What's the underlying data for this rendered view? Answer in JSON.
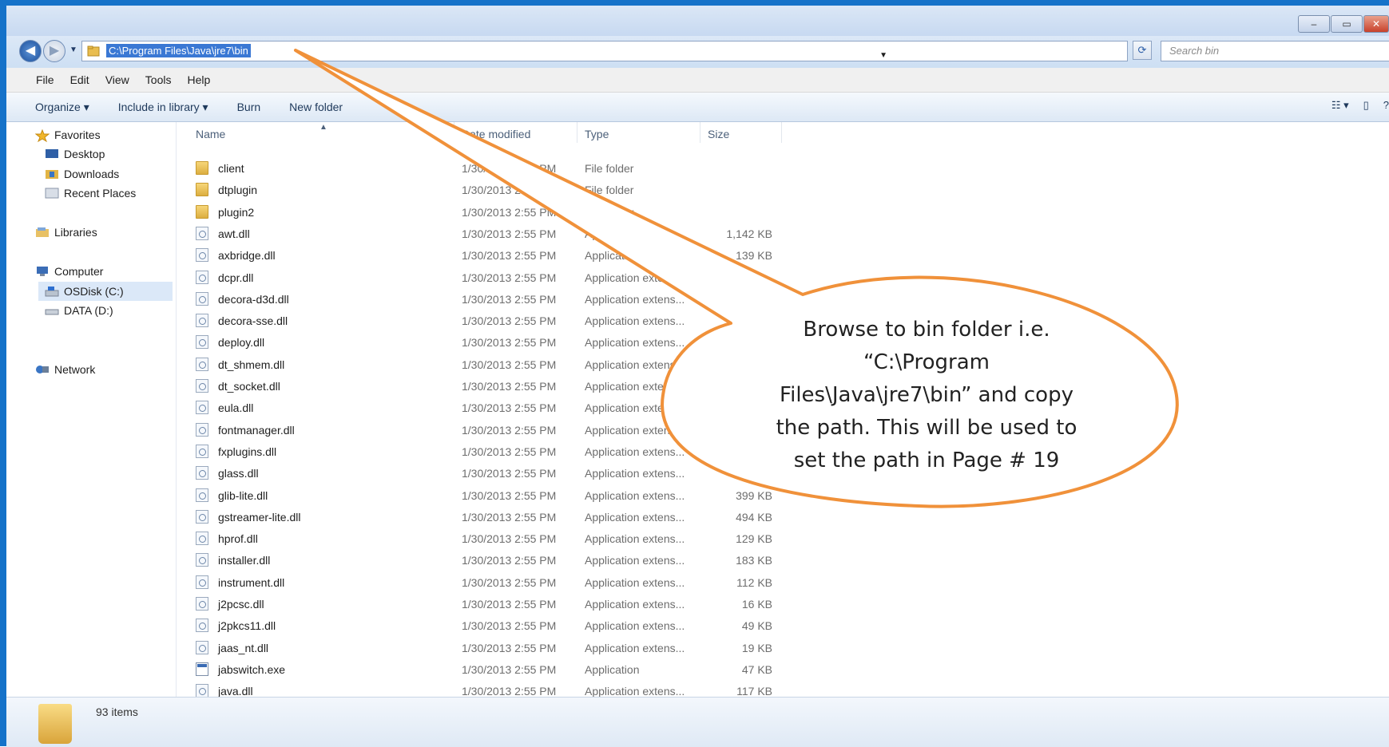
{
  "window": {
    "minimize": "–",
    "maximize": "▭",
    "close": "✕"
  },
  "address": {
    "path": "C:\\Program Files\\Java\\jre7\\bin",
    "search_placeholder": "Search bin"
  },
  "menu": [
    "File",
    "Edit",
    "View",
    "Tools",
    "Help"
  ],
  "commands": [
    "Organize ▾",
    "Include in library ▾",
    "Burn",
    "New folder"
  ],
  "nav": {
    "favorites": "Favorites",
    "desktop": "Desktop",
    "downloads": "Downloads",
    "recent": "Recent Places",
    "libraries": "Libraries",
    "computer": "Computer",
    "osdisk": "OSDisk (C:)",
    "data": "DATA (D:)",
    "network": "Network"
  },
  "columns": {
    "name": "Name",
    "date": "Date modified",
    "type": "Type",
    "size": "Size"
  },
  "files": [
    {
      "name": "client",
      "date": "1/30/2013 2:55 PM",
      "type": "File folder",
      "size": "",
      "kind": "folder"
    },
    {
      "name": "dtplugin",
      "date": "1/30/2013 2:55 PM",
      "type": "File folder",
      "size": "",
      "kind": "folder"
    },
    {
      "name": "plugin2",
      "date": "1/30/2013 2:55 PM",
      "type": "File folder",
      "size": "",
      "kind": "folder"
    },
    {
      "name": "awt.dll",
      "date": "1/30/2013 2:55 PM",
      "type": "Application extens...",
      "size": "1,142 KB",
      "kind": "dll"
    },
    {
      "name": "axbridge.dll",
      "date": "1/30/2013 2:55 PM",
      "type": "Application extens...",
      "size": "139 KB",
      "kind": "dll"
    },
    {
      "name": "dcpr.dll",
      "date": "1/30/2013 2:55 PM",
      "type": "Application extens...",
      "size": "",
      "kind": "dll"
    },
    {
      "name": "decora-d3d.dll",
      "date": "1/30/2013 2:55 PM",
      "type": "Application extens...",
      "size": "",
      "kind": "dll"
    },
    {
      "name": "decora-sse.dll",
      "date": "1/30/2013 2:55 PM",
      "type": "Application extens...",
      "size": "",
      "kind": "dll"
    },
    {
      "name": "deploy.dll",
      "date": "1/30/2013 2:55 PM",
      "type": "Application extens...",
      "size": "",
      "kind": "dll"
    },
    {
      "name": "dt_shmem.dll",
      "date": "1/30/2013 2:55 PM",
      "type": "Application extens...",
      "size": "",
      "kind": "dll"
    },
    {
      "name": "dt_socket.dll",
      "date": "1/30/2013 2:55 PM",
      "type": "Application extens...",
      "size": "",
      "kind": "dll"
    },
    {
      "name": "eula.dll",
      "date": "1/30/2013 2:55 PM",
      "type": "Application extens...",
      "size": "",
      "kind": "dll"
    },
    {
      "name": "fontmanager.dll",
      "date": "1/30/2013 2:55 PM",
      "type": "Application extens...",
      "size": "",
      "kind": "dll"
    },
    {
      "name": "fxplugins.dll",
      "date": "1/30/2013 2:55 PM",
      "type": "Application extens...",
      "size": "",
      "kind": "dll"
    },
    {
      "name": "glass.dll",
      "date": "1/30/2013 2:55 PM",
      "type": "Application extens...",
      "size": "",
      "kind": "dll"
    },
    {
      "name": "glib-lite.dll",
      "date": "1/30/2013 2:55 PM",
      "type": "Application extens...",
      "size": "399 KB",
      "kind": "dll"
    },
    {
      "name": "gstreamer-lite.dll",
      "date": "1/30/2013 2:55 PM",
      "type": "Application extens...",
      "size": "494 KB",
      "kind": "dll"
    },
    {
      "name": "hprof.dll",
      "date": "1/30/2013 2:55 PM",
      "type": "Application extens...",
      "size": "129 KB",
      "kind": "dll"
    },
    {
      "name": "installer.dll",
      "date": "1/30/2013 2:55 PM",
      "type": "Application extens...",
      "size": "183 KB",
      "kind": "dll"
    },
    {
      "name": "instrument.dll",
      "date": "1/30/2013 2:55 PM",
      "type": "Application extens...",
      "size": "112 KB",
      "kind": "dll"
    },
    {
      "name": "j2pcsc.dll",
      "date": "1/30/2013 2:55 PM",
      "type": "Application extens...",
      "size": "16 KB",
      "kind": "dll"
    },
    {
      "name": "j2pkcs11.dll",
      "date": "1/30/2013 2:55 PM",
      "type": "Application extens...",
      "size": "49 KB",
      "kind": "dll"
    },
    {
      "name": "jaas_nt.dll",
      "date": "1/30/2013 2:55 PM",
      "type": "Application extens...",
      "size": "19 KB",
      "kind": "dll"
    },
    {
      "name": "jabswitch.exe",
      "date": "1/30/2013 2:55 PM",
      "type": "Application",
      "size": "47 KB",
      "kind": "exe"
    },
    {
      "name": "java.dll",
      "date": "1/30/2013 2:55 PM",
      "type": "Application extens...",
      "size": "117 KB",
      "kind": "dll"
    }
  ],
  "status": {
    "count": "93 items"
  },
  "callout": {
    "lines": [
      "Browse to bin folder i.e.",
      "“C:\\Program",
      "Files\\Java\\jre7\\bin” and copy",
      "the path. This will be used to",
      "set the path in Page # 19"
    ],
    "stroke": "#f0913a"
  }
}
